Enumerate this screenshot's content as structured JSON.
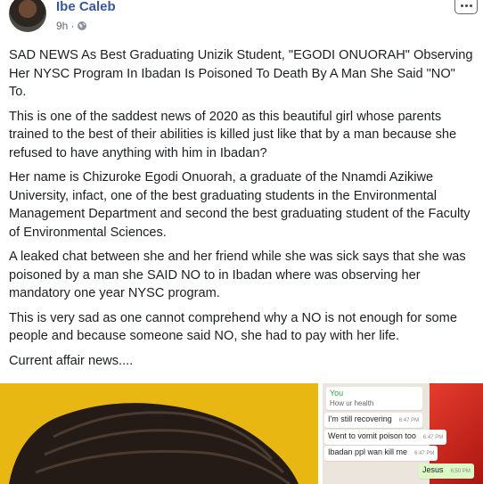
{
  "post": {
    "author": "Ibe Caleb",
    "time": "9h",
    "dot": "·",
    "paragraphs": [
      "SAD NEWS As Best Graduating Unizik Student, \"EGODI ONUORAH\" Observing Her NYSC Program In Ibadan Is Poisoned To Death By A Man She Said \"NO\" To.",
      "This is one of the saddest news of 2020 as this beautiful girl whose parents trained to the best of their abilities is killed just like that by a man because she refused to have anything with him in Ibadan?",
      "Her name is Chizuroke Egodi Onuorah, a graduate of the Nnamdi Azikiwe University, infact, one of the best graduating students in the Environmental Management Department and second the best graduating student of the Faculty of Environmental Sciences.",
      "A leaked chat between she and her friend while she was sick says that she was poisoned by a man she SAID NO to in Ibadan where was observing her mandatory one year NYSC program.",
      "This is very sad as one cannot comprehend why a NO is not enough for some people and because someone said NO, she had to pay with her life.",
      "Current affair news...."
    ]
  },
  "chat": {
    "quote_name": "You",
    "quote_text": "How ur health",
    "messages": [
      {
        "text": "I'm still recovering",
        "time": "6:47 PM"
      },
      {
        "text": "Went to vomit poison too",
        "time": "6:47 PM"
      },
      {
        "text": "Ibadan ppl wan kill me",
        "time": "6:47 PM"
      },
      {
        "text": "Jesus",
        "time": "6:50 PM"
      }
    ]
  },
  "icons": {
    "privacy": "globe-icon",
    "menu": "more-options-icon"
  },
  "colors": {
    "author": "#385898",
    "photo_background": "#e8b712",
    "chat_background": "#ece5dd",
    "sent_bubble": "#dcf8c6"
  }
}
